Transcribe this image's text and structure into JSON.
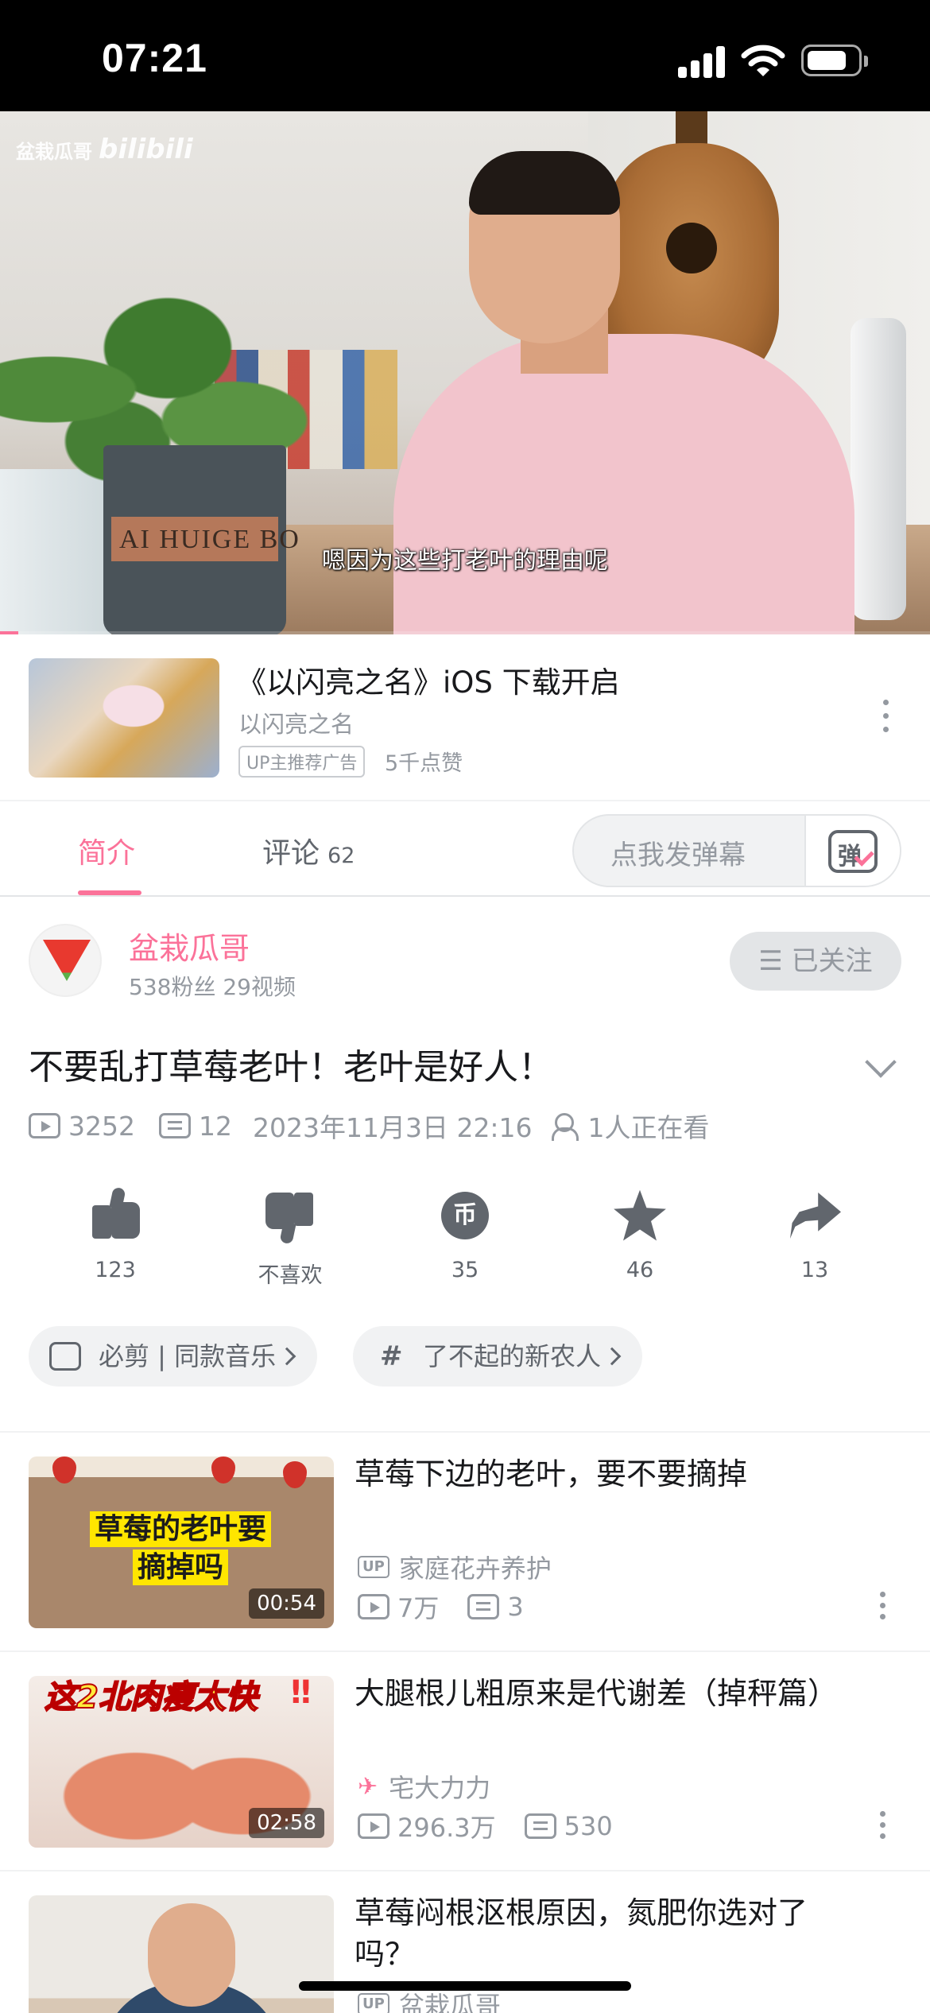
{
  "status_bar": {
    "time": "07:21"
  },
  "video": {
    "watermark_up": "盆栽瓜哥",
    "watermark_brand": "bilibili",
    "pot_text": "AI HUIGE BO",
    "subtitle": "嗯因为这些打老叶的理由呢",
    "progress": 0.02
  },
  "ad": {
    "title": "《以闪亮之名》iOS 下载开启",
    "subtitle": "以闪亮之名",
    "tag": "UP主推荐广告",
    "likes": "5千点赞"
  },
  "tabs": {
    "intro": "简介",
    "comments": "评论",
    "comments_count": "62",
    "danmaku_placeholder": "点我发弹幕",
    "danmaku_icon_glyph": "弹"
  },
  "uploader": {
    "name": "盆栽瓜哥",
    "stats": "538粉丝  29视频",
    "follow_label": "☰ 已关注"
  },
  "video_info": {
    "title": "不要乱打草莓老叶！老叶是好人！",
    "views": "3252",
    "danmaku": "12",
    "date": "2023年11月3日 22:16",
    "watching": "1人正在看"
  },
  "actions": {
    "like": "123",
    "dislike": "不喜欢",
    "coin": "35",
    "coin_glyph": "币",
    "favorite": "46",
    "share": "13"
  },
  "tag_chips": [
    {
      "label": "必剪 | 同款音乐"
    },
    {
      "label": "了不起的新农人"
    }
  ],
  "chip_hash": "#",
  "recommendations": [
    {
      "title": "草莓下边的老叶，要不要摘掉",
      "up": "家庭花卉养护",
      "views": "7万",
      "danmaku": "3",
      "duration": "00:54",
      "thumb_text_1": "草莓的老叶要",
      "thumb_text_2": "摘掉吗"
    },
    {
      "title": "大腿根儿粗原来是代谢差（掉秤篇）",
      "up": "宅大力力",
      "views": "296.3万",
      "danmaku": "530",
      "duration": "02:58",
      "thumb_text": "这2北肉瘦太快",
      "thumb_bang": "‼"
    },
    {
      "title": "草莓闷根沤根原因，氮肥你选对了吗？",
      "up": "盆栽瓜哥"
    }
  ],
  "badges": {
    "up": "UP"
  },
  "colors": {
    "accent": "#fb7299",
    "text_primary": "#18191c",
    "text_secondary": "#9499a0",
    "icon_gray": "#61666d"
  }
}
